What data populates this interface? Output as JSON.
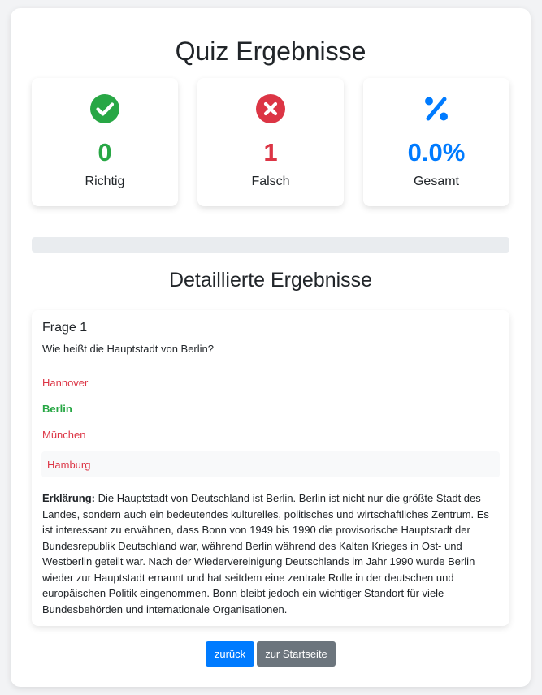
{
  "title": "Quiz Ergebnisse",
  "stats": {
    "correct": {
      "value": "0",
      "label": "Richtig",
      "icon": "check-circle-icon",
      "color": "#28a745"
    },
    "wrong": {
      "value": "1",
      "label": "Falsch",
      "icon": "x-circle-icon",
      "color": "#dc3545"
    },
    "total": {
      "value": "0.0%",
      "label": "Gesamt",
      "icon": "percent-icon",
      "color": "#007bff"
    }
  },
  "progress": {
    "percent": 0
  },
  "details_title": "Detaillierte Ergebnisse",
  "question": {
    "title": "Frage 1",
    "text": "Wie heißt die Hauptstadt von Berlin?",
    "options": [
      {
        "text": "Hannover",
        "state": "wrong"
      },
      {
        "text": "Berlin",
        "state": "correct"
      },
      {
        "text": "München",
        "state": "wrong"
      },
      {
        "text": "Hamburg",
        "state": "selected-wrong"
      }
    ],
    "explanation_label": "Erklärung:",
    "explanation": "Die Hauptstadt von Deutschland ist Berlin. Berlin ist nicht nur die größte Stadt des Landes, sondern auch ein bedeutendes kulturelles, politisches und wirtschaftliches Zentrum. Es ist interessant zu erwähnen, dass Bonn von 1949 bis 1990 die provisorische Hauptstadt der Bundesrepublik Deutschland war, während Berlin während des Kalten Krieges in Ost- und Westberlin geteilt war. Nach der Wiedervereinigung Deutschlands im Jahr 1990 wurde Berlin wieder zur Hauptstadt ernannt und hat seitdem eine zentrale Rolle in der deutschen und europäischen Politik eingenommen. Bonn bleibt jedoch ein wichtiger Standort für viele Bundesbehörden und internationale Organisationen."
  },
  "buttons": {
    "back": "zurück",
    "home": "zur Startseite"
  }
}
